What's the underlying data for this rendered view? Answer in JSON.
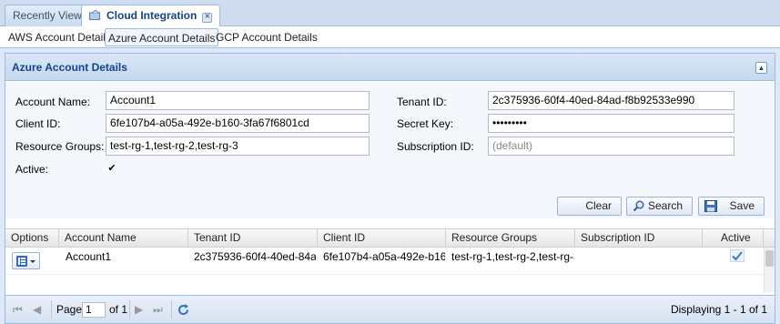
{
  "tabs": [
    {
      "label": "Recently View"
    },
    {
      "label": "Cloud Integration",
      "close_icon": "close-icon"
    }
  ],
  "subtabs": [
    "AWS Account Details",
    "Azure Account Details",
    "GCP Account Details"
  ],
  "panel": {
    "title": "Azure Account Details"
  },
  "form": {
    "account_name": {
      "label": "Account Name:",
      "value": "Account1"
    },
    "client_id": {
      "label": "Client ID:",
      "value": "6fe107b4-a05a-492e-b160-3fa67f6801cd"
    },
    "resource_groups": {
      "label": "Resource Groups:",
      "value": "test-rg-1,test-rg-2,test-rg-3"
    },
    "active": {
      "label": "Active:",
      "checked": true
    },
    "tenant_id": {
      "label": "Tenant ID:",
      "value": "2c375936-60f4-40ed-84ad-f8b92533e990"
    },
    "secret_key": {
      "label": "Secret Key:",
      "value": "•••••••••"
    },
    "subscription_id": {
      "label": "Subscription ID:",
      "placeholder": "(default)"
    }
  },
  "buttons": {
    "clear": "Clear",
    "search": "Search",
    "save": "Save"
  },
  "grid": {
    "columns": [
      "Options",
      "Account Name",
      "Tenant ID",
      "Client ID",
      "Resource Groups",
      "Subscription ID",
      "Active"
    ],
    "rows": [
      {
        "account_name": "Account1",
        "tenant_id": "2c375936-60f4-40ed-84a...",
        "client_id": "6fe107b4-a05a-492e-b16...",
        "resource_groups": "test-rg-1,test-rg-2,test-rg-3",
        "subscription_id": "",
        "active": true
      }
    ]
  },
  "pager": {
    "page_label": "Page",
    "page_value": "1",
    "of_label": "of 1",
    "display": "Displaying 1 - 1 of 1"
  },
  "colors": {
    "accent": "#15428b",
    "border": "#99bbe8",
    "panel_header": "#c4d8f0"
  }
}
